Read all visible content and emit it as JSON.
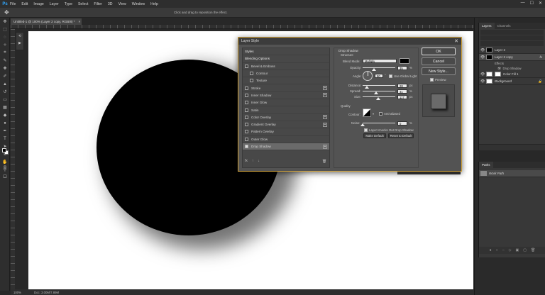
{
  "app": {
    "logo": "Ps"
  },
  "menu": [
    "File",
    "Edit",
    "Image",
    "Layer",
    "Type",
    "Select",
    "Filter",
    "3D",
    "View",
    "Window",
    "Help"
  ],
  "window_controls": [
    "—",
    "☐",
    "✕"
  ],
  "options_bar": {
    "hint": "Click and drag to reposition the effect."
  },
  "document": {
    "tab_title": "Untitled-1 @ 100% (Layer 2 copy, RGB/8) *",
    "close": "×"
  },
  "status": {
    "zoom": "100%",
    "doc_size": "Doc: 3.00M/7.89M"
  },
  "layers_panel": {
    "tabs": [
      "Layers",
      "Channels"
    ],
    "layers": [
      {
        "name": "Layer 2",
        "thumb": "black",
        "fx": ""
      },
      {
        "name": "Layer 2 copy",
        "thumb": "black",
        "fx": "fx",
        "selected": true
      },
      {
        "name": "Color Fill 1",
        "thumb": "white",
        "fx": ""
      },
      {
        "name": "Background",
        "thumb": "white",
        "fx": ""
      }
    ],
    "effects": {
      "label": "Effects",
      "item": "Drop Shadow"
    }
  },
  "paths_panel": {
    "tab": "Paths",
    "item": "Work Path"
  },
  "dialog": {
    "title": "Layer Style",
    "close": "✕",
    "styles": [
      {
        "label": "Styles",
        "checkbox": false,
        "plus": false,
        "indent": false,
        "header": true
      },
      {
        "label": "Blending Options",
        "checkbox": false,
        "plus": false,
        "indent": false,
        "header": true
      },
      {
        "label": "Bevel & Emboss",
        "checkbox": true,
        "checked": false,
        "plus": false,
        "indent": false
      },
      {
        "label": "Contour",
        "checkbox": true,
        "checked": false,
        "plus": false,
        "indent": true
      },
      {
        "label": "Texture",
        "checkbox": true,
        "checked": false,
        "plus": false,
        "indent": true
      },
      {
        "label": "Stroke",
        "checkbox": true,
        "checked": false,
        "plus": true,
        "indent": false
      },
      {
        "label": "Inner Shadow",
        "checkbox": true,
        "checked": false,
        "plus": true,
        "indent": false
      },
      {
        "label": "Inner Glow",
        "checkbox": true,
        "checked": false,
        "plus": false,
        "indent": false
      },
      {
        "label": "Satin",
        "checkbox": true,
        "checked": false,
        "plus": false,
        "indent": false
      },
      {
        "label": "Color Overlay",
        "checkbox": true,
        "checked": false,
        "plus": true,
        "indent": false
      },
      {
        "label": "Gradient Overlay",
        "checkbox": true,
        "checked": false,
        "plus": true,
        "indent": false
      },
      {
        "label": "Pattern Overlay",
        "checkbox": true,
        "checked": false,
        "plus": false,
        "indent": false
      },
      {
        "label": "Outer Glow",
        "checkbox": true,
        "checked": false,
        "plus": false,
        "indent": false
      },
      {
        "label": "Drop Shadow",
        "checkbox": true,
        "checked": true,
        "plus": true,
        "indent": false,
        "active": true
      }
    ],
    "styles_footer": [
      "fx",
      "↑",
      "↓"
    ],
    "trash": "🗑",
    "drop_shadow": {
      "title": "Drop Shadow",
      "structure": "Structure",
      "blend_mode_label": "Blend Mode:",
      "blend_mode": "Multiply",
      "shadow_color": "#000000",
      "opacity_label": "Opacity:",
      "opacity": "35",
      "opacity_fraction": 0.35,
      "angle_label": "Angle:",
      "angle": "90",
      "angle_unit": "°",
      "global_light_label": "Use Global Light",
      "global_light": true,
      "distance_label": "Distance:",
      "distance": "28",
      "distance_fraction": 0.12,
      "spread_label": "Spread:",
      "spread": "41",
      "spread_fraction": 0.41,
      "size_label": "Size:",
      "size": "117",
      "size_fraction": 0.47,
      "unit_px": "px",
      "unit_pct": "%",
      "quality": "Quality",
      "contour_label": "Contour:",
      "anti_aliased_label": "Anti-aliased",
      "noise_label": "Noise:",
      "noise": "0",
      "noise_fraction": 0,
      "knockout_label": "Layer Knocks Out Drop Shadow",
      "knockout": true,
      "make_default": "Make Default",
      "reset_default": "Reset to Default"
    },
    "buttons": {
      "ok": "OK",
      "cancel": "Cancel",
      "new_style": "New Style...",
      "preview_label": "Preview",
      "preview": true
    }
  }
}
